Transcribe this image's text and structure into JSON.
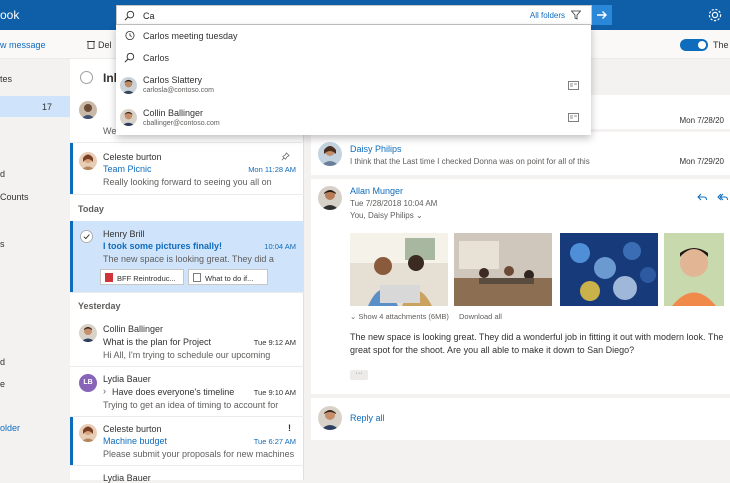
{
  "app": {
    "brand_fragment": "ook"
  },
  "search": {
    "value": "Ca",
    "scope_label": "All folders"
  },
  "suggestions": [
    {
      "kind": "history",
      "icon": "history-icon",
      "text": "Carlos meeting tuesday"
    },
    {
      "kind": "search",
      "icon": "search-icon",
      "text": "Carlos"
    },
    {
      "kind": "person",
      "name": "Carlos Slattery",
      "email": "carlosla@contoso.com"
    },
    {
      "kind": "person",
      "name": "Collin Ballinger",
      "email": "cballinger@contoso.com"
    }
  ],
  "command_bar": {
    "new_message": "w message",
    "delete": "Del",
    "toggle_label": "The",
    "toggle_on": true
  },
  "sidebar": {
    "items": [
      {
        "label": "tes"
      },
      {
        "label": "",
        "count": "17",
        "selected": true
      },
      {
        "label": "d"
      },
      {
        "label": "Counts"
      },
      {
        "label": "s"
      },
      {
        "label": "d"
      },
      {
        "label": "e"
      },
      {
        "label": "older",
        "link": true
      }
    ]
  },
  "message_list": {
    "title": "Inl",
    "groups": {
      "today": "Today",
      "yesterday": "Yesterday"
    },
    "items": [
      {
        "preview_line2": "We"
      },
      {
        "sender": "Celeste burton",
        "subject": "Team Picnic",
        "time": "Mon 11:28 AM",
        "preview": "Really looking forward to seeing you all on",
        "pinned": true
      },
      {
        "sender": "Henry Brill",
        "subject": "I took some pictures finally!",
        "time": "10:04 AM",
        "preview": "The new space is looking great. They did a",
        "attachments": [
          "BFF Reintroduc...",
          "What to do if..."
        ]
      },
      {
        "sender": "Collin Ballinger",
        "subject": "What is the plan for Project",
        "time": "Tue 9:12 AM",
        "preview": "Hi All, I'm trying to schedule our upcoming"
      },
      {
        "sender": "Lydia Bauer",
        "initials": "LB",
        "subject": "Have does everyone's timeline",
        "time": "Tue 9:10 AM",
        "preview": "Trying to get an idea of timing to account for"
      },
      {
        "sender": "Celeste burton",
        "subject": "Machine budget",
        "time": "Tue 6:27 AM",
        "preview": "Please submit your proposals for new machines",
        "flag": "!"
      },
      {
        "sender": "Lydia Bauer"
      }
    ]
  },
  "reading_pane": {
    "top_dates": [
      "Mon 7/28/20",
      "Mon 7/29/20"
    ],
    "daisy": {
      "name": "Daisy Philips",
      "snippet": "I think that the Last time I checked Donna was on point for all of this"
    },
    "allan": {
      "name": "Allan Munger",
      "date": "Tue 7/28/2018 10:04 AM",
      "to": "You, Daisy Philips",
      "show_attachments": "Show 4 attachments (6MB)",
      "download_all": "Download all",
      "body_line1": "The new space is looking great. They did a wonderful job in fitting it out with modern look. The",
      "body_line2": "great spot for the shoot. Are you all able to make it down to San Diego?",
      "more": "···"
    },
    "reply_all": "Reply all"
  },
  "colors": {
    "accent": "#0f6cbd",
    "header": "#0f5ea8",
    "selected": "#cfe4fa",
    "lydia_avatar": "#8764b8"
  }
}
